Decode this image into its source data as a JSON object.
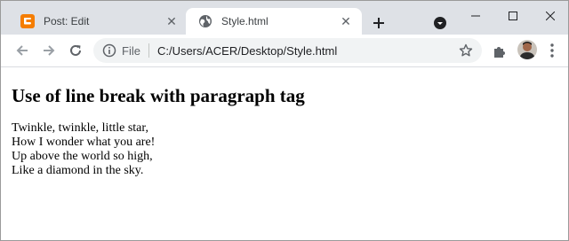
{
  "tabs": [
    {
      "title": "Post: Edit",
      "active": false,
      "favicon": "blogger-icon"
    },
    {
      "title": "Style.html",
      "active": true,
      "favicon": "globe-icon"
    }
  ],
  "address_bar": {
    "scheme_label": "File",
    "url": "C:/Users/ACER/Desktop/Style.html"
  },
  "page": {
    "heading": "Use of line break with paragraph tag",
    "lines": [
      "Twinkle, twinkle, little star,",
      "How I wonder what you are!",
      "Up above the world so high,",
      "Like a diamond in the sky."
    ]
  },
  "colors": {
    "tabstrip_bg": "#dee1e6",
    "omnibox_bg": "#f1f3f4",
    "blogger_orange": "#f57d00"
  }
}
